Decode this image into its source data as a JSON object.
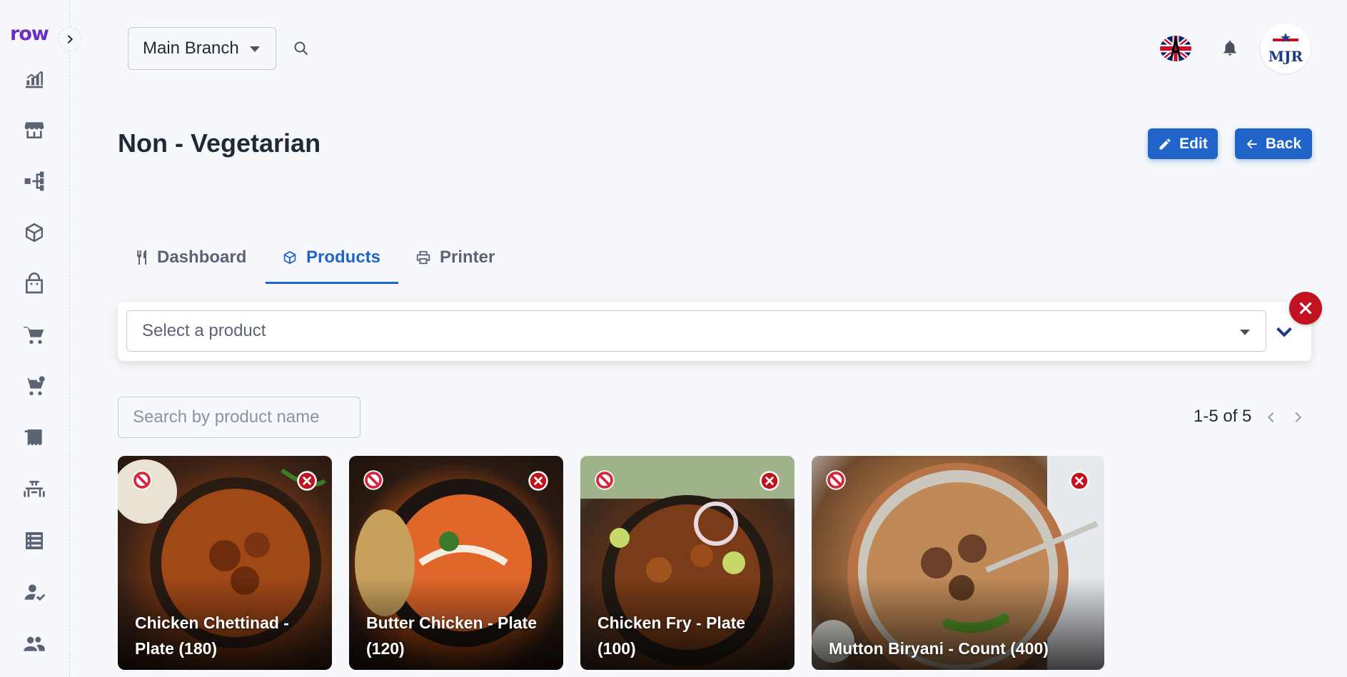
{
  "app": {
    "logo_text": "row"
  },
  "header": {
    "branch_label": "Main Branch",
    "flag_icon": "uk-flag-icon",
    "avatar_text": "MJR"
  },
  "page": {
    "title": "Non - Vegetarian"
  },
  "actions": {
    "edit_label": "Edit",
    "back_label": "Back"
  },
  "tabs": [
    {
      "label": "Dashboard",
      "icon": "utensils-icon",
      "active": false
    },
    {
      "label": "Products",
      "icon": "cube-icon",
      "active": true
    },
    {
      "label": "Printer",
      "icon": "printer-icon",
      "active": false
    }
  ],
  "product_select": {
    "placeholder": "Select a product"
  },
  "search": {
    "placeholder": "Search by product name"
  },
  "pagination": {
    "text": "1-5 of 5"
  },
  "products": [
    {
      "name": "Chicken Chettinad - Plate (180)"
    },
    {
      "name": "Butter Chicken - Plate (120)"
    },
    {
      "name": "Chicken Fry - Plate (100)"
    },
    {
      "name": "Mutton Biryani - Count (400)"
    }
  ],
  "colors": {
    "accent": "#2064c9",
    "danger": "#c1121f",
    "background": "#f6f8fb",
    "brand": "#6b2fc6"
  }
}
